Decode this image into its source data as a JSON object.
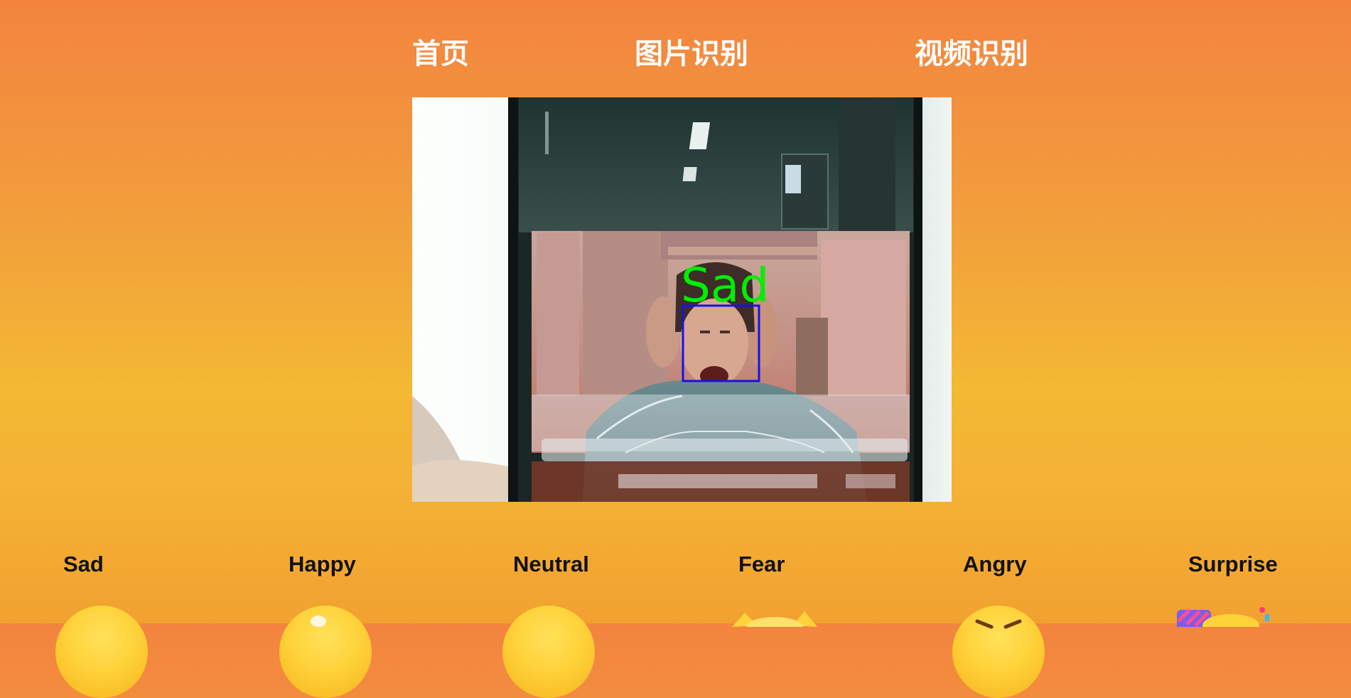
{
  "nav": {
    "home": "首页",
    "image_recognition": "图片识别",
    "video_recognition": "视频识别"
  },
  "video": {
    "detected_label": "Sad",
    "label_color": "#00ee00",
    "box_color": "#1a10e6"
  },
  "emotions": [
    {
      "label": "Sad",
      "icon": "sad-emoji-icon"
    },
    {
      "label": "Happy",
      "icon": "happy-emoji-icon"
    },
    {
      "label": "Neutral",
      "icon": "neutral-emoji-icon"
    },
    {
      "label": "Fear",
      "icon": "fear-emoji-icon"
    },
    {
      "label": "Angry",
      "icon": "angry-emoji-icon"
    },
    {
      "label": "Surprise",
      "icon": "surprise-emoji-icon"
    }
  ],
  "colors": {
    "bg_top": "#f3843f",
    "bg_middle": "#f3b834",
    "nav_text": "#ffffff"
  }
}
